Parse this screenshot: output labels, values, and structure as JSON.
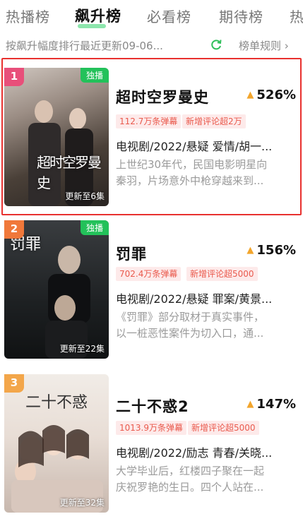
{
  "tabs": [
    {
      "label": "热播榜",
      "active": false
    },
    {
      "label": "飙升榜",
      "active": true
    },
    {
      "label": "必看榜",
      "active": false
    },
    {
      "label": "期待榜",
      "active": false
    },
    {
      "label": "热",
      "active": false
    }
  ],
  "subbar": {
    "description": "按飙升幅度排行最近更新09-06...",
    "refresh_icon": "refresh-icon",
    "rules_label": "榜单规则 ›"
  },
  "colors": {
    "accent_green": "#23c15a",
    "tag_red": "#ea5a4d",
    "tag_bg": "#fdeaea",
    "highlight_border": "#e8312f",
    "rank1": "#e84f7a",
    "rank2": "#f0783a",
    "rank3": "#f3a64a"
  },
  "items": [
    {
      "rank": "1",
      "badge": "独播",
      "update": "更新至6集",
      "poster_text": "超时空罗曼史",
      "title": "超时空罗曼史",
      "rise": "526%",
      "tags": [
        "112.7万条弹幕",
        "新增评论超2万"
      ],
      "meta": "电视剧/2022/悬疑 爱情/胡一...",
      "synopsis": [
        "上世纪30年代，民国电影明星向",
        "秦羽，片场意外中枪穿越来到..."
      ]
    },
    {
      "rank": "2",
      "badge": "独播",
      "update": "更新至22集",
      "poster_text": "罚罪",
      "title": "罚罪",
      "rise": "156%",
      "tags": [
        "702.4万条弹幕",
        "新增评论超5000"
      ],
      "meta": "电视剧/2022/悬疑 罪案/黄景...",
      "synopsis": [
        "《罚罪》部分取材于真实事件，",
        "以一桩恶性案件为切入口，通..."
      ]
    },
    {
      "rank": "3",
      "badge": "",
      "update": "更新至32集",
      "poster_text": "二十不惑",
      "title": "二十不惑2",
      "rise": "147%",
      "tags": [
        "1013.9万条弹幕",
        "新增评论超5000"
      ],
      "meta": "电视剧/2022/励志 青春/关晓...",
      "synopsis": [
        "大学毕业后，红楼四子聚在一起",
        "庆祝罗艳的生日。四个人站在..."
      ]
    }
  ]
}
